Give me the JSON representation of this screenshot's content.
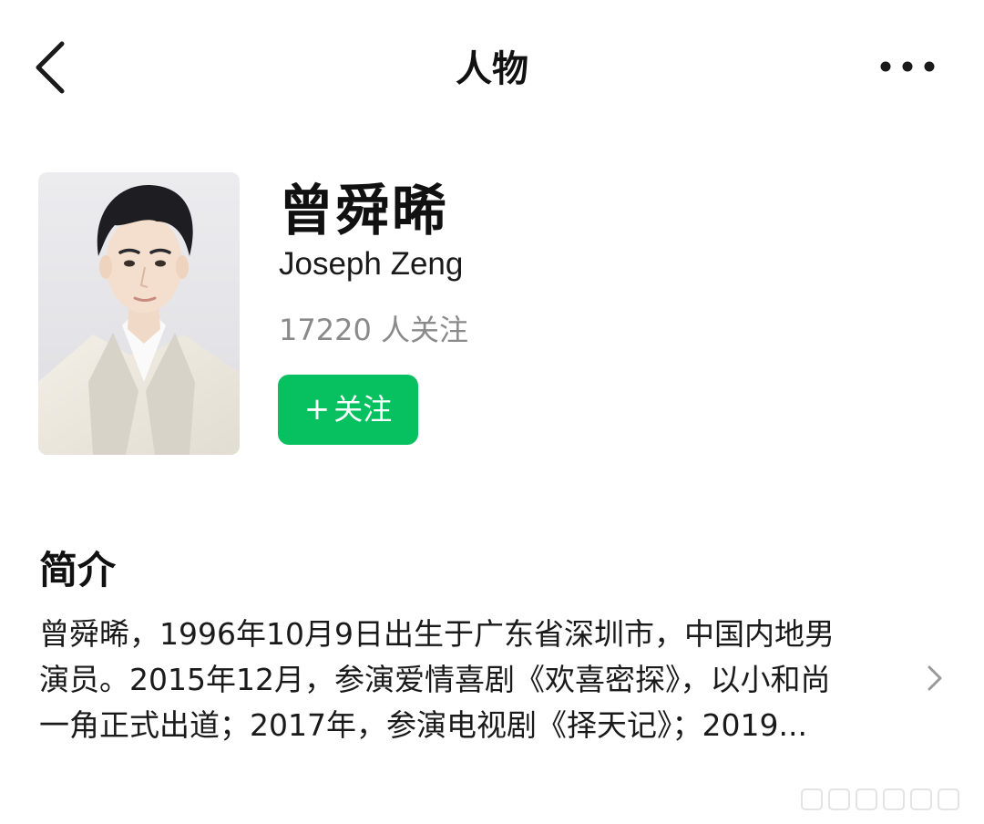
{
  "nav": {
    "title": "人物",
    "back_icon": "chevron-left-icon",
    "more_icon": "more-dots-icon"
  },
  "profile": {
    "name_cn": "曾舜晞",
    "name_en": "Joseph Zeng",
    "followers": "17220 人关注",
    "follow_button": {
      "plus": "+",
      "label": "关注"
    },
    "accent_color": "#07c160"
  },
  "intro": {
    "title": "简介",
    "lines": [
      "曾舜晞，1996年10月9日出生于广东省深圳市，中国内地男",
      "演员。2015年12月，参演爱情喜剧《欢喜密探》，以小和尚",
      "一角正式出道；2017年，参演电视剧《择天记》；2019..."
    ],
    "expand_icon": "chevron-right-icon"
  }
}
